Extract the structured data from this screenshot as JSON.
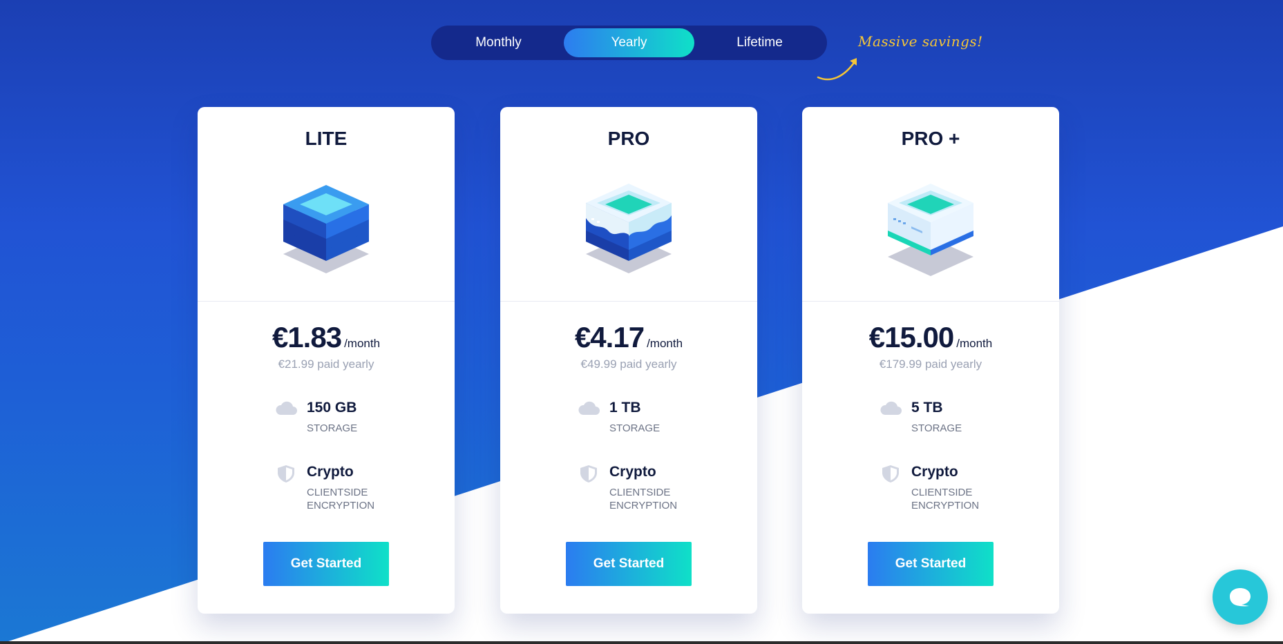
{
  "billing_toggle": {
    "options": [
      "Monthly",
      "Yearly",
      "Lifetime"
    ],
    "selected": "Yearly"
  },
  "promo_note": "Massive savings!",
  "colors": {
    "background_top": "#1b3fb3",
    "background_bottom": "#1b78d4",
    "toggle_bg": "#14298c",
    "accent_gradient_start": "#2d7cf0",
    "accent_gradient_end": "#0fe0c8",
    "promo_text": "#f6c636",
    "chat_button": "#27c7d9"
  },
  "plans": [
    {
      "name": "LITE",
      "price": "€1.83",
      "period": "/month",
      "billed": "€21.99 paid yearly",
      "features": [
        {
          "icon": "cloud-icon",
          "value": "150 GB",
          "label": "STORAGE"
        },
        {
          "icon": "shield-icon",
          "value": "Crypto",
          "label": "CLIENTSIDE ENCRYPTION"
        }
      ],
      "cta": "Get Started"
    },
    {
      "name": "PRO",
      "price": "€4.17",
      "period": "/month",
      "billed": "€49.99 paid yearly",
      "features": [
        {
          "icon": "cloud-icon",
          "value": "1 TB",
          "label": "STORAGE"
        },
        {
          "icon": "shield-icon",
          "value": "Crypto",
          "label": "CLIENTSIDE ENCRYPTION"
        }
      ],
      "cta": "Get Started"
    },
    {
      "name": "PRO +",
      "price": "€15.00",
      "period": "/month",
      "billed": "€179.99 paid yearly",
      "features": [
        {
          "icon": "cloud-icon",
          "value": "5 TB",
          "label": "STORAGE"
        },
        {
          "icon": "shield-icon",
          "value": "Crypto",
          "label": "CLIENTSIDE ENCRYPTION"
        }
      ],
      "cta": "Get Started"
    }
  ],
  "chat_widget": {
    "icon": "chat-bubble-icon"
  }
}
